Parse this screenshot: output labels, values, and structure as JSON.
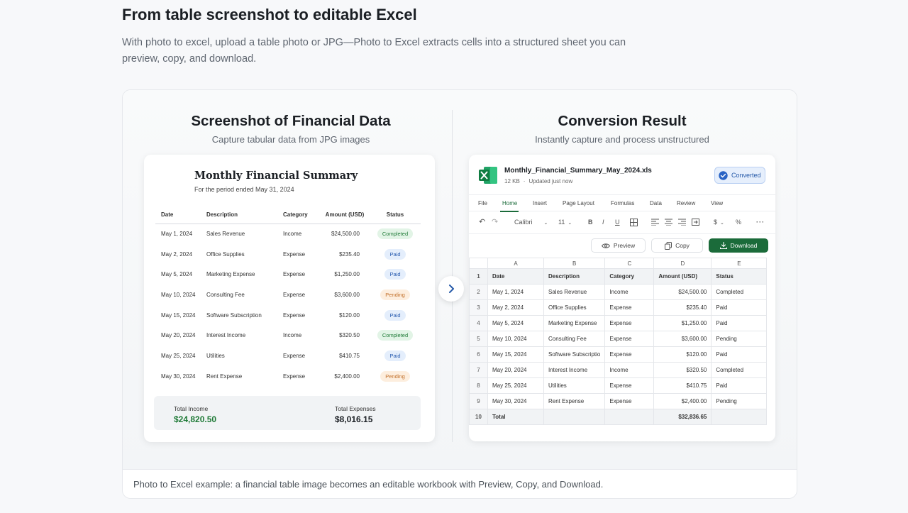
{
  "page": {
    "heading": "From table screenshot to editable Excel",
    "subheading": "With photo to excel, upload a table photo or JPG—Photo to Excel extracts cells into a structured sheet you can preview, copy, and download."
  },
  "left_panel": {
    "title": "Screenshot of Financial Data",
    "subtitle": "Capture tabular data from JPG images",
    "doc_title": "Monthly Financial Summary",
    "doc_period": "For the period ended May 31, 2024",
    "columns": [
      "Date",
      "Description",
      "Category",
      "Amount (USD)",
      "Status"
    ],
    "rows": [
      {
        "date": "May 1, 2024",
        "description": "Sales Revenue",
        "category": "Income",
        "amount": "$24,500.00",
        "status": "Completed"
      },
      {
        "date": "May 2, 2024",
        "description": "Office Supplies",
        "category": "Expense",
        "amount": "$235.40",
        "status": "Paid"
      },
      {
        "date": "May 5, 2024",
        "description": "Marketing Expense",
        "category": "Expense",
        "amount": "$1,250.00",
        "status": "Paid"
      },
      {
        "date": "May 10, 2024",
        "description": "Consulting Fee",
        "category": "Expense",
        "amount": "$3,600.00",
        "status": "Pending"
      },
      {
        "date": "May 15, 2024",
        "description": "Software Subscription",
        "category": "Expense",
        "amount": "$120.00",
        "status": "Paid"
      },
      {
        "date": "May 20, 2024",
        "description": "Interest Income",
        "category": "Income",
        "amount": "$320.50",
        "status": "Completed"
      },
      {
        "date": "May 25, 2024",
        "description": "Utilities",
        "category": "Expense",
        "amount": "$410.75",
        "status": "Paid"
      },
      {
        "date": "May 30, 2024",
        "description": "Rent Expense",
        "category": "Expense",
        "amount": "$2,400.00",
        "status": "Pending"
      }
    ],
    "total_income_label": "Total Income",
    "total_income_value": "$24,820.50",
    "total_expenses_label": "Total Expenses",
    "total_expenses_value": "$8,016.15"
  },
  "right_panel": {
    "title": "Conversion Result",
    "subtitle": "Instantly capture and process unstructured",
    "file_name": "Monthly_Financial_Summary_May_2024.xls",
    "file_size": "12 KB",
    "file_updated": "Updated just now",
    "badge": "Converted",
    "menu": [
      "File",
      "Home",
      "Insert",
      "Page Layout",
      "Formulas",
      "Data",
      "Review",
      "View"
    ],
    "toolbar": {
      "font": "Calibri",
      "size": "11",
      "bold": "B",
      "italic": "I",
      "underline": "U",
      "currency": "$",
      "percent": "%"
    },
    "buttons": {
      "preview": "Preview",
      "copy": "Copy",
      "download": "Download"
    },
    "column_letters": [
      "A",
      "B",
      "C",
      "D",
      "E"
    ],
    "row_numbers": [
      "1",
      "2",
      "3",
      "4",
      "5",
      "6",
      "7",
      "8",
      "9",
      "10"
    ],
    "header_row": [
      "Date",
      "Description",
      "Category",
      "Amount (USD)",
      "Status"
    ],
    "data_rows": [
      [
        "May 1, 2024",
        "Sales Revenue",
        "Income",
        "$24,500.00",
        "Completed"
      ],
      [
        "May 2, 2024",
        "Office Supplies",
        "Expense",
        "$235.40",
        "Paid"
      ],
      [
        "May 5, 2024",
        "Marketing Expense",
        "Expense",
        "$1,250.00",
        "Paid"
      ],
      [
        "May 10, 2024",
        "Consulting Fee",
        "Expense",
        "$3,600.00",
        "Pending"
      ],
      [
        "May 15, 2024",
        "Software Subscriptio",
        "Expense",
        "$120.00",
        "Paid"
      ],
      [
        "May 20, 2024",
        "Interest Income",
        "Income",
        "$320.50",
        "Completed"
      ],
      [
        "May 25, 2024",
        "Utilities",
        "Expense",
        "$410.75",
        "Paid"
      ],
      [
        "May 30, 2024",
        "Rent Expense",
        "Expense",
        "$2,400.00",
        "Pending"
      ]
    ],
    "total_row": [
      "Total",
      "",
      "",
      "$32,836.65",
      ""
    ]
  },
  "caption": "Photo to Excel example: a financial table image becomes an editable workbook with Preview, Copy, and Download.",
  "colors": {
    "accent_green": "#1b6b3a",
    "income_green": "#1f7a37",
    "badge_blue": "#2458a8"
  }
}
